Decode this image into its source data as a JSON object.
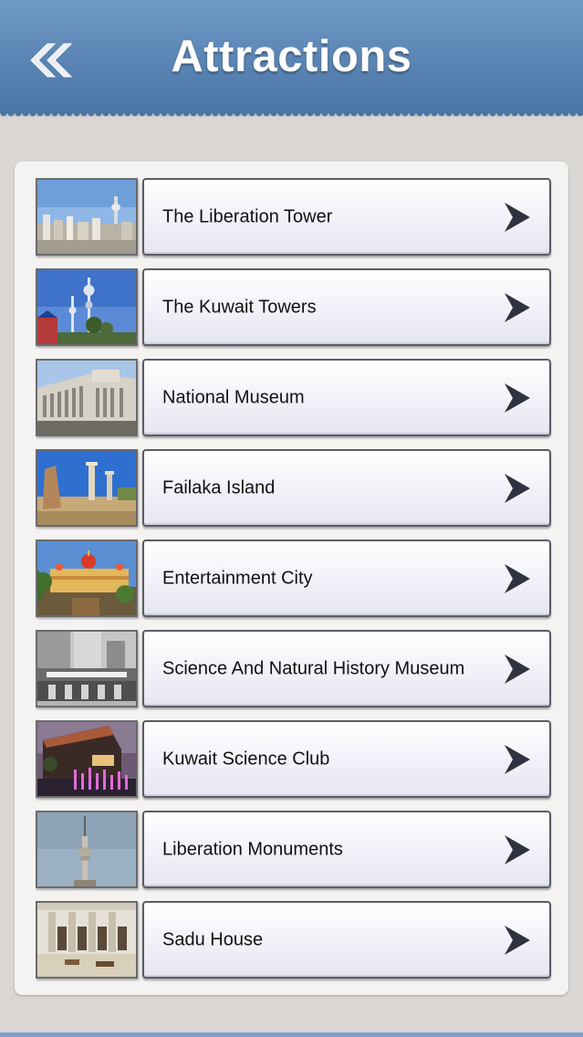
{
  "header": {
    "title": "Attractions",
    "back_icon": "double-chevron-left-icon"
  },
  "colors": {
    "header": "#5a84b3",
    "panel": "#f4f3f2",
    "background": "#d9d6d3",
    "chevron": "#2f3340"
  },
  "list": {
    "chevron_icon": "chevron-right-icon",
    "items": [
      {
        "label": "The Liberation Tower",
        "thumb": "city-skyline-tower-photo"
      },
      {
        "label": "The Kuwait Towers",
        "thumb": "kuwait-towers-photo"
      },
      {
        "label": "National Museum",
        "thumb": "museum-building-photo"
      },
      {
        "label": "Failaka Island",
        "thumb": "ancient-ruins-photo"
      },
      {
        "label": "Entertainment City",
        "thumb": "domed-palace-photo"
      },
      {
        "label": "Science And Natural History Museum",
        "thumb": "museum-storefront-photo"
      },
      {
        "label": "Kuwait Science Club",
        "thumb": "science-club-fountain-photo"
      },
      {
        "label": "Liberation Monuments",
        "thumb": "liberation-tower-sky-photo"
      },
      {
        "label": "Sadu House",
        "thumb": "courtyard-photo"
      }
    ]
  }
}
